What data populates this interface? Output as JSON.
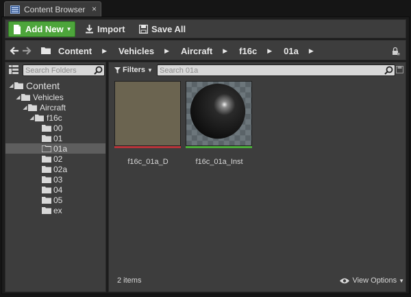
{
  "tab": {
    "title": "Content Browser",
    "close": "×"
  },
  "toolbar": {
    "add_new_label": "Add New",
    "import_label": "Import",
    "save_all_label": "Save All"
  },
  "path": {
    "crumbs": [
      "Content",
      "Vehicles",
      "Aircraft",
      "f16c",
      "01a"
    ]
  },
  "folders_search": {
    "placeholder": "Search Folders"
  },
  "tree": {
    "items": [
      {
        "label": "Content",
        "depth": 0,
        "expanded": true
      },
      {
        "label": "Vehicles",
        "depth": 1,
        "expanded": true
      },
      {
        "label": "Aircraft",
        "depth": 2,
        "expanded": true
      },
      {
        "label": "f16c",
        "depth": 3,
        "expanded": true
      },
      {
        "label": "00",
        "depth": 4
      },
      {
        "label": "01",
        "depth": 4
      },
      {
        "label": "01a",
        "depth": 4,
        "selected": true
      },
      {
        "label": "02",
        "depth": 4
      },
      {
        "label": "02a",
        "depth": 4
      },
      {
        "label": "03",
        "depth": 4
      },
      {
        "label": "04",
        "depth": 4
      },
      {
        "label": "05",
        "depth": 4
      },
      {
        "label": "ex",
        "depth": 4
      }
    ]
  },
  "assets": {
    "filters_label": "Filters",
    "search_placeholder": "Search 01a",
    "items": [
      {
        "name": "f16c_01a_D",
        "type_color": "#b8343a"
      },
      {
        "name": "f16c_01a_Inst",
        "type_color": "#4caf3a"
      }
    ],
    "count_label": "2 items",
    "view_options_label": "View Options"
  },
  "colors": {
    "accent_green": "#4da53b",
    "texture_swatch": "#6b6450",
    "panel": "#3d3d3d"
  }
}
